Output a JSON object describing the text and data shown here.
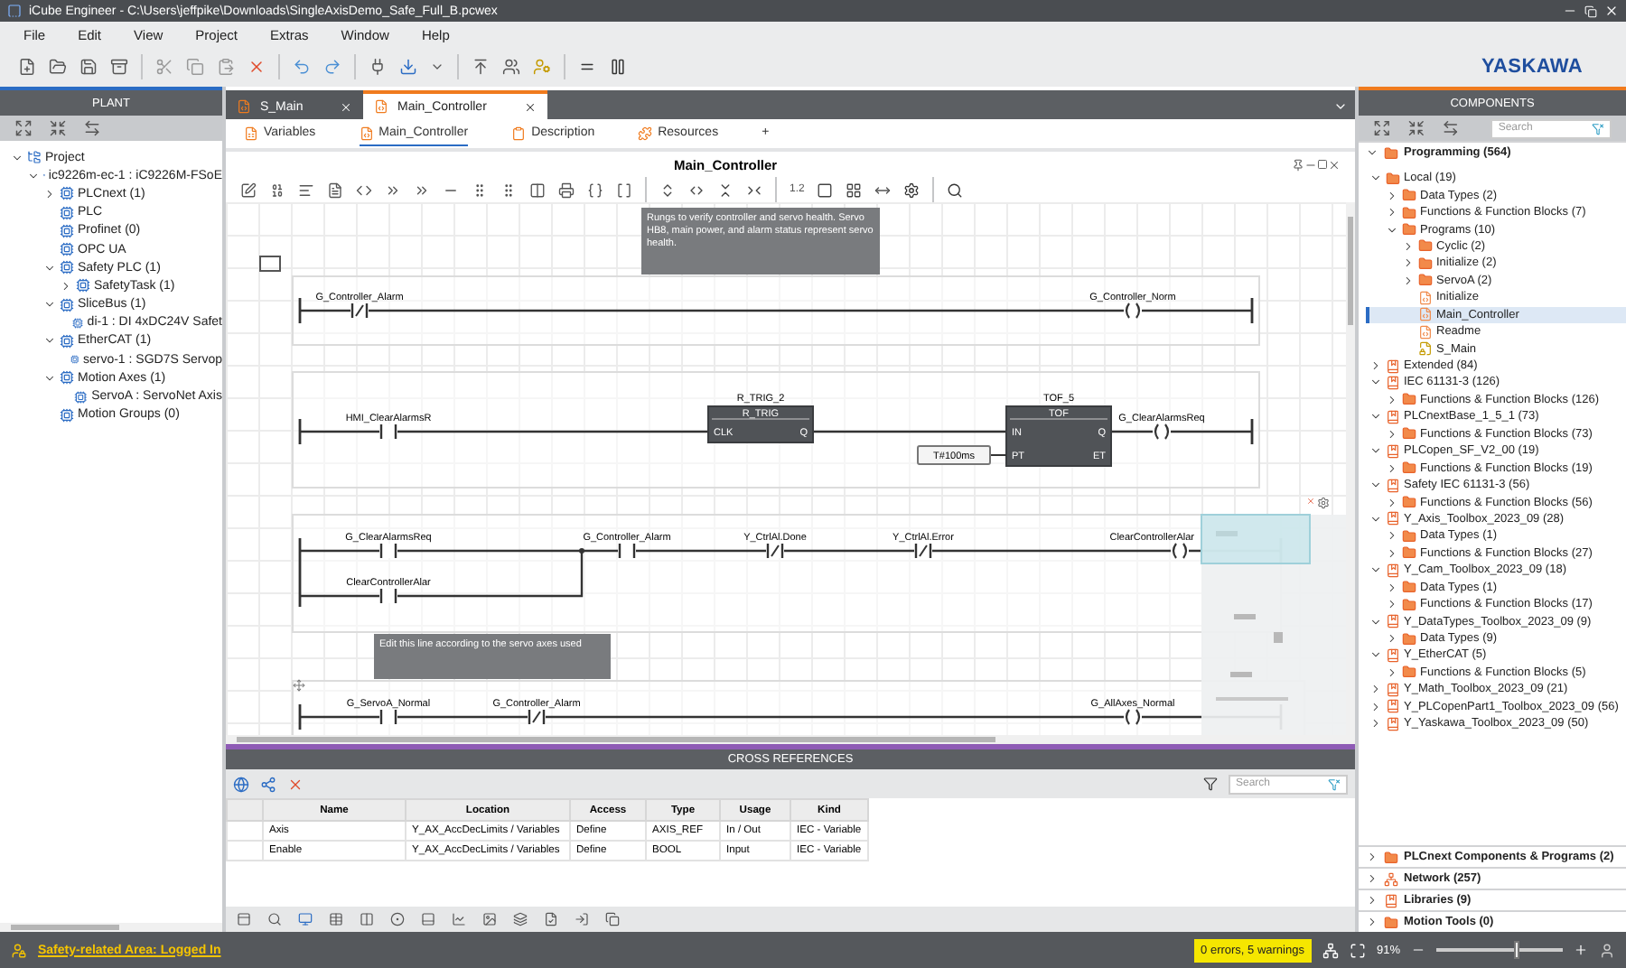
{
  "window": {
    "title": "iCube Engineer - C:\\Users\\jeffpike\\Downloads\\SingleAxisDemo_Safe_Full_B.pcwex"
  },
  "menu": [
    "File",
    "Edit",
    "View",
    "Project",
    "Extras",
    "Window",
    "Help"
  ],
  "logo": "YASKAWA",
  "plant": {
    "title": "PLANT",
    "tree": [
      {
        "label": "Project",
        "expanded": true,
        "children": [
          {
            "label": "ic9226m-ec-1 : iC9226M-FSoE",
            "expanded": true,
            "children": [
              {
                "label": "PLCnext (1)",
                "expanded": false
              },
              {
                "label": "PLC"
              },
              {
                "label": "Profinet (0)"
              },
              {
                "label": "OPC UA"
              },
              {
                "label": "Safety PLC (1)",
                "expanded": true,
                "children": [
                  {
                    "label": "SafetyTask (1)",
                    "expanded": false
                  }
                ]
              },
              {
                "label": "SliceBus (1)",
                "expanded": true,
                "children": [
                  {
                    "label": "di-1 : DI 4xDC24V Safet"
                  }
                ]
              },
              {
                "label": "EtherCAT (1)",
                "expanded": true,
                "children": [
                  {
                    "label": "servo-1 : SGD7S Servop"
                  }
                ]
              },
              {
                "label": "Motion Axes (1)",
                "expanded": true,
                "children": [
                  {
                    "label": "ServoA : ServoNet Axis"
                  }
                ]
              },
              {
                "label": "Motion Groups (0)"
              }
            ]
          }
        ]
      }
    ]
  },
  "document_tabs": [
    {
      "label": "S_Main",
      "selected": false
    },
    {
      "label": "Main_Controller",
      "selected": true
    }
  ],
  "editor_tabs": [
    {
      "label": "Variables",
      "selected": false
    },
    {
      "label": "Main_Controller",
      "selected": true
    },
    {
      "label": "Description",
      "selected": false
    },
    {
      "label": "Resources",
      "selected": false
    }
  ],
  "add_tab": "+",
  "editor": {
    "title": "Main_Controller",
    "zoom_label": "1.2",
    "comments": [
      "Rungs to verify controller and servo health. Servo HB8, main power, and alarm status represent servo health.",
      "Edit this line according to the servo axes used"
    ],
    "rungs": [
      {
        "elements": [
          {
            "kind": "negated_contact",
            "label": "G_Controller_Alarm"
          },
          {
            "kind": "coil",
            "label": "G_Controller_Norm"
          }
        ]
      },
      {
        "elements": [
          {
            "kind": "contact",
            "label": "HMI_ClearAlarmsR"
          },
          {
            "kind": "block",
            "instance": "R_TRIG_2",
            "type": "R_TRIG",
            "inputs": [
              "CLK"
            ],
            "outputs": [
              "Q"
            ]
          },
          {
            "kind": "block",
            "instance": "TOF_5",
            "type": "TOF",
            "inputs": [
              "IN",
              "PT"
            ],
            "outputs": [
              "Q",
              "ET"
            ],
            "constant": "T#100ms"
          },
          {
            "kind": "coil",
            "label": "G_ClearAlarmsReq"
          }
        ]
      },
      {
        "elements": [
          {
            "kind": "contact",
            "label": "G_ClearAlarmsReq"
          },
          {
            "kind": "parallel_contact",
            "label": "ClearControllerAlar"
          },
          {
            "kind": "contact",
            "label": "G_Controller_Alarm"
          },
          {
            "kind": "negated_contact",
            "label": "Y_CtrlAl.Done"
          },
          {
            "kind": "negated_contact",
            "label": "Y_CtrlAl.Error"
          },
          {
            "kind": "coil",
            "label": "ClearControllerAlar"
          }
        ]
      },
      {
        "elements": [
          {
            "kind": "contact",
            "label": "G_ServoA_Normal"
          },
          {
            "kind": "negated_contact",
            "label": "G_Controller_Alarm"
          },
          {
            "kind": "coil",
            "label": "G_AllAxes_Normal"
          }
        ]
      }
    ]
  },
  "cross_references": {
    "title": "CROSS REFERENCES",
    "search": {
      "placeholder": "Search"
    },
    "columns": [
      "Name",
      "Location",
      "Access",
      "Type",
      "Usage",
      "Kind"
    ],
    "rows": [
      [
        "Axis",
        "Y_AX_AccDecLimits / Variables",
        "Define",
        "AXIS_REF",
        "In / Out",
        "IEC - Variable"
      ],
      [
        "Enable",
        "Y_AX_AccDecLimits / Variables",
        "Define",
        "BOOL",
        "Input",
        "IEC - Variable"
      ]
    ]
  },
  "components": {
    "title": "COMPONENTS",
    "search": {
      "placeholder": "Search"
    },
    "sections": [
      {
        "label": "Programming (564)",
        "kind": "folder",
        "expanded": true,
        "children": [
          {
            "label": "Local (19)",
            "kind": "folder",
            "selected": false,
            "expanded": true,
            "children": [
              {
                "label": "Data Types (2)",
                "kind": "folder",
                "selected": false,
                "expanded": false
              },
              {
                "label": "Functions & Function Blocks (7)",
                "kind": "folder",
                "selected": false,
                "expanded": false
              },
              {
                "label": "Programs (10)",
                "kind": "folder",
                "selected": false,
                "expanded": true,
                "children": [
                  {
                    "label": "Cyclic (2)",
                    "kind": "folder",
                    "selected": false,
                    "expanded": false
                  },
                  {
                    "label": "Initialize (2)",
                    "kind": "folder",
                    "selected": false,
                    "expanded": false
                  },
                  {
                    "label": "ServoA (2)",
                    "kind": "folder",
                    "selected": false,
                    "expanded": false
                  },
                  {
                    "label": "Initialize",
                    "kind": "program",
                    "selected": false
                  },
                  {
                    "label": "Main_Controller",
                    "kind": "program",
                    "selected": true
                  },
                  {
                    "label": "Readme",
                    "kind": "program",
                    "selected": false
                  },
                  {
                    "label": "S_Main",
                    "kind": "safety_program",
                    "selected": false
                  }
                ]
              }
            ]
          },
          {
            "label": "Extended (84)",
            "kind": "library",
            "selected": false,
            "expanded": false
          },
          {
            "label": "IEC 61131-3 (126)",
            "kind": "library",
            "selected": false,
            "expanded": true,
            "children": [
              {
                "label": "Functions & Function Blocks (126)",
                "kind": "folder",
                "selected": false,
                "expanded": false
              }
            ]
          },
          {
            "label": "PLCnextBase_1_5_1 (73)",
            "kind": "library",
            "selected": false,
            "expanded": true,
            "children": [
              {
                "label": "Functions & Function Blocks (73)",
                "kind": "folder",
                "selected": false,
                "expanded": false
              }
            ]
          },
          {
            "label": "PLCopen_SF_V2_00 (19)",
            "kind": "library",
            "selected": false,
            "expanded": true,
            "children": [
              {
                "label": "Functions & Function Blocks (19)",
                "kind": "folder",
                "selected": false,
                "expanded": false
              }
            ]
          },
          {
            "label": "Safety IEC 61131-3 (56)",
            "kind": "library",
            "selected": false,
            "expanded": true,
            "children": [
              {
                "label": "Functions & Function Blocks (56)",
                "kind": "folder",
                "selected": false,
                "expanded": false
              }
            ]
          },
          {
            "label": "Y_Axis_Toolbox_2023_09 (28)",
            "kind": "library",
            "selected": false,
            "expanded": true,
            "children": [
              {
                "label": "Data Types (1)",
                "kind": "folder",
                "selected": false,
                "expanded": false
              },
              {
                "label": "Functions & Function Blocks (27)",
                "kind": "folder",
                "selected": false,
                "expanded": false
              }
            ]
          },
          {
            "label": "Y_Cam_Toolbox_2023_09 (18)",
            "kind": "library",
            "selected": false,
            "expanded": true,
            "children": [
              {
                "label": "Data Types (1)",
                "kind": "folder",
                "selected": false,
                "expanded": false
              },
              {
                "label": "Functions & Function Blocks (17)",
                "kind": "folder",
                "selected": false,
                "expanded": false
              }
            ]
          },
          {
            "label": "Y_DataTypes_Toolbox_2023_09 (9)",
            "kind": "library",
            "selected": false,
            "expanded": true,
            "children": [
              {
                "label": "Data Types (9)",
                "kind": "folder",
                "selected": false,
                "expanded": false
              }
            ]
          },
          {
            "label": "Y_EtherCAT (5)",
            "kind": "library",
            "selected": false,
            "expanded": true,
            "children": [
              {
                "label": "Functions & Function Blocks (5)",
                "kind": "folder",
                "selected": false,
                "expanded": false
              }
            ]
          },
          {
            "label": "Y_Math_Toolbox_2023_09 (21)",
            "kind": "library",
            "selected": false,
            "expanded": false
          },
          {
            "label": "Y_PLCopenPart1_Toolbox_2023_09 (56)",
            "kind": "library",
            "selected": false,
            "expanded": false
          },
          {
            "label": "Y_Yaskawa_Toolbox_2023_09 (50)",
            "kind": "library",
            "selected": false,
            "expanded": false
          }
        ]
      },
      {
        "label": "PLCnext Components & Programs (2)",
        "kind": "folder",
        "expanded": false
      },
      {
        "label": "Network (257)",
        "kind": "network",
        "expanded": false
      },
      {
        "label": "Libraries (9)",
        "kind": "library",
        "expanded": false
      },
      {
        "label": "Motion Tools (0)",
        "kind": "folder",
        "expanded": false
      }
    ]
  },
  "status_bar": {
    "safety": "Safety-related Area: Logged In",
    "messages": "0 errors, 5 warnings",
    "zoom": "91%",
    "zoom_slider": {
      "level": 0.62
    }
  }
}
